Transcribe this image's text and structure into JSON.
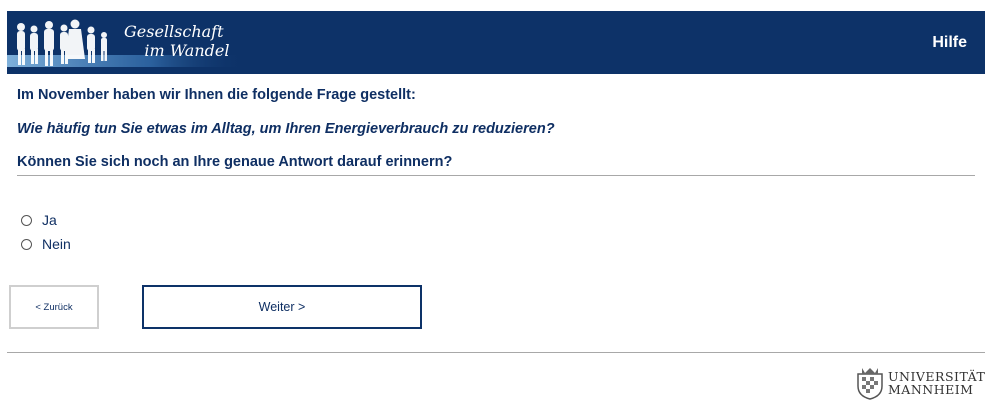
{
  "header": {
    "logo_text": "Gesellschaft\n    im Wandel",
    "help_label": "Hilfe"
  },
  "question": {
    "intro": "Im November haben wir Ihnen die folgende Frage gestellt:",
    "quoted": "Wie häufig tun Sie etwas im Alltag, um Ihren Energieverbrauch zu reduzieren?",
    "prompt": "Können Sie sich noch an Ihre genaue Antwort darauf erinnern?"
  },
  "options": [
    {
      "label": "Ja",
      "selected": false
    },
    {
      "label": "Nein",
      "selected": false
    }
  ],
  "nav": {
    "back_label": "< Zurück",
    "next_label": "Weiter >"
  },
  "footer": {
    "university_text": "UNIVERSITÄT\nMANNHEIM"
  },
  "colors": {
    "brand_navy": "#0d3268",
    "text_navy": "#0f2f63"
  }
}
